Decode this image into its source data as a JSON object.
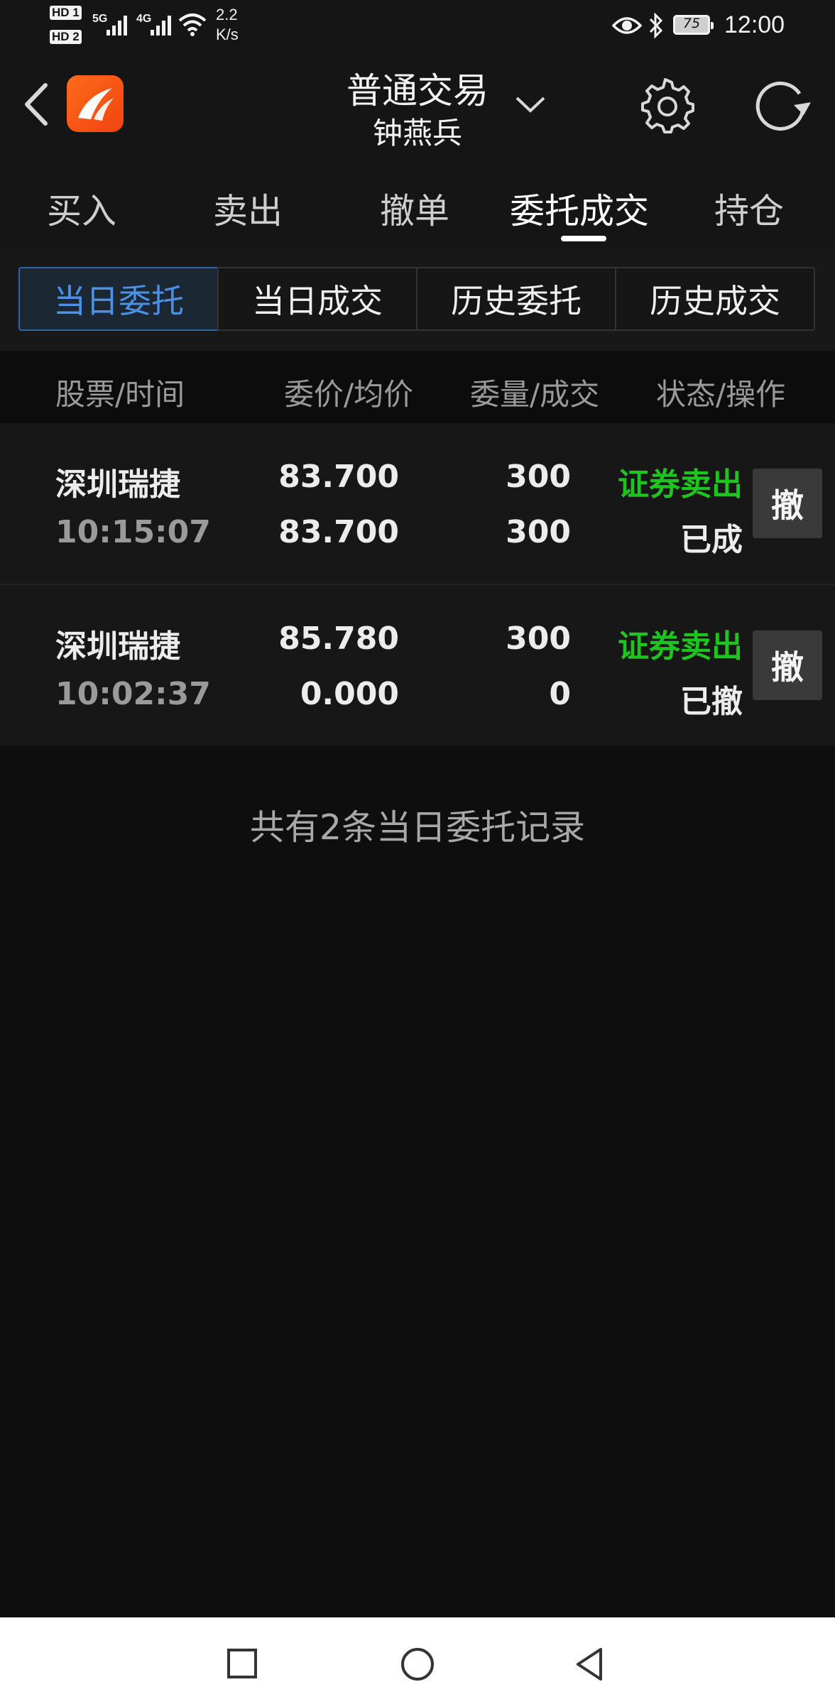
{
  "status_bar": {
    "sim1": "HD 1",
    "sim2": "HD 2",
    "net1": "5G",
    "net2": "4G",
    "speed_value": "2.2",
    "speed_unit": "K/s",
    "battery": "75",
    "time": "12:00"
  },
  "header": {
    "title": "普通交易",
    "account": "钟燕兵"
  },
  "main_tabs": [
    {
      "label": "买入"
    },
    {
      "label": "卖出"
    },
    {
      "label": "撤单"
    },
    {
      "label": "委托成交"
    },
    {
      "label": "持仓"
    }
  ],
  "sub_tabs": [
    {
      "label": "当日委托"
    },
    {
      "label": "当日成交"
    },
    {
      "label": "历史委托"
    },
    {
      "label": "历史成交"
    }
  ],
  "table": {
    "columns": [
      "股票/时间",
      "委价/均价",
      "委量/成交",
      "状态/操作"
    ],
    "rows": [
      {
        "stock": "深圳瑞捷",
        "time": "10:15:07",
        "order_price": "83.700",
        "avg_price": "83.700",
        "order_qty": "300",
        "filled_qty": "300",
        "side": "证券卖出",
        "status": "已成",
        "action": "撤"
      },
      {
        "stock": "深圳瑞捷",
        "time": "10:02:37",
        "order_price": "85.780",
        "avg_price": "0.000",
        "order_qty": "300",
        "filled_qty": "0",
        "side": "证券卖出",
        "status": "已撤",
        "action": "撤"
      }
    ]
  },
  "summary": "共有2条当日委托记录",
  "colors": {
    "accent": "#4b92e6",
    "sell_side": "#1fc51f",
    "logo": "#f04410"
  }
}
